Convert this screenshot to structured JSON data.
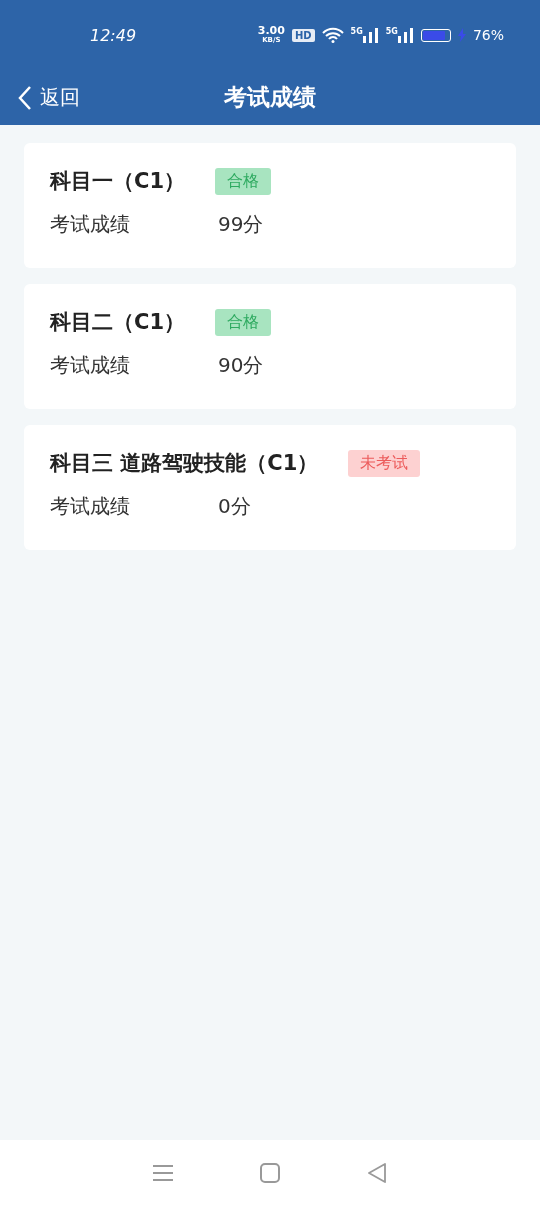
{
  "status_bar": {
    "time": "12:49",
    "speed": "3.00",
    "speed_unit": "KB/S",
    "hd": "HD",
    "network_labels": [
      "5G",
      "5G"
    ],
    "battery": "76%",
    "charging": true
  },
  "nav": {
    "back": "返回",
    "title": "考试成绩"
  },
  "subjects": [
    {
      "name": "科目一（C1）",
      "status": "合格",
      "kind": "pass",
      "score_label": "考试成绩",
      "score": "99分"
    },
    {
      "name": "科目二（C1）",
      "status": "合格",
      "kind": "pass",
      "score_label": "考试成绩",
      "score": "90分"
    },
    {
      "name": "科目三 道路驾驶技能（C1）",
      "status": "未考试",
      "kind": "absent",
      "score_label": "考试成绩",
      "score": "0分"
    }
  ]
}
